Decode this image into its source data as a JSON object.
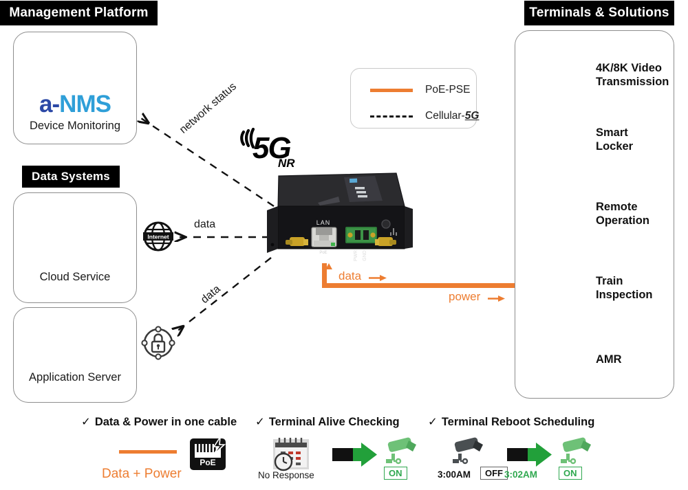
{
  "sections": {
    "management": {
      "badge": "Management Platform"
    },
    "data_systems": {
      "badge": "Data Systems"
    },
    "terminals": {
      "badge": "Terminals & Solutions"
    }
  },
  "cards": {
    "device_monitoring": {
      "label": "Device Monitoring",
      "logo_part1": "a-",
      "logo_part2": "NMS",
      "icon": "admin-user-alert-icon",
      "logo_color_primary": "#2c49a6",
      "logo_color_secondary": "#2f9fd8"
    },
    "cloud_service": {
      "label": "Cloud Service",
      "icon": "cloud-data-transfer-icon"
    },
    "application_server": {
      "label": "Application Server",
      "icon": "server-rack-database-icon"
    }
  },
  "legend": {
    "items": [
      {
        "style": "solid",
        "color": "#ED7D31",
        "label": "PoE-PSE"
      },
      {
        "style": "dashed",
        "color": "#111111",
        "label_prefix": "Cellular-",
        "label_emphasis": "5G"
      }
    ]
  },
  "device": {
    "name": "5G NR Industrial Router",
    "wireless_tag_main": "5G",
    "wireless_tag_sub": "NR",
    "ports": {
      "lan_label": "LAN",
      "poe_label": "PoE",
      "pwr_label": "PWR",
      "gnd_label": "GND"
    }
  },
  "connections": [
    {
      "id": "network-status",
      "label": "network status",
      "style": "dashed",
      "direction": "to-device-monitoring"
    },
    {
      "id": "data-internet",
      "label": "data",
      "style": "dashed",
      "direction": "to-cloud-service"
    },
    {
      "id": "data-vpn",
      "label": "data",
      "style": "dashed",
      "direction": "to-application-server"
    },
    {
      "id": "poe-data",
      "label": "data",
      "style": "solid",
      "color": "#ED7D31"
    },
    {
      "id": "poe-power",
      "label": "power",
      "style": "solid",
      "color": "#ED7D31"
    }
  ],
  "nodes": {
    "internet": {
      "label": "Internet",
      "icon": "globe-internet-icon"
    },
    "vpn": {
      "label": "",
      "icon": "secure-lock-icon"
    }
  },
  "terminals": {
    "items": [
      {
        "label": "4K/8K Video\nTransmission",
        "line1": "4K/8K Video",
        "line2": "Transmission",
        "icon": "dome-camera-icon"
      },
      {
        "label": "Smart Locker",
        "line1": "Smart",
        "line2": "Locker",
        "icon": "smart-locker-icon"
      },
      {
        "label": "Remote Operation",
        "line1": "Remote",
        "line2": "Operation",
        "icon": "excavator-icon"
      },
      {
        "label": "Train Inspection",
        "line1": "Train",
        "line2": "Inspection",
        "icon": "train-icon"
      },
      {
        "label": "AMR",
        "line1": "AMR",
        "line2": "",
        "icon": "amr-robot-icon"
      }
    ]
  },
  "features": [
    {
      "check": "✓",
      "title": "Data & Power in one cable",
      "caption": "Data + Power",
      "caption_color": "#ED7D31",
      "icon": "poe-rj45-icon",
      "icon_label": "PoE"
    },
    {
      "check": "✓",
      "title": "Terminal  Alive Checking",
      "status_caption": "No Response",
      "state_label": "ON",
      "icon_before": "calendar-clock-icon",
      "icon_arrow": "transition-arrow-icon",
      "icon_after": "camera-on-icon"
    },
    {
      "check": "✓",
      "title": "Terminal  Reboot Scheduling",
      "time_before": "3:00AM",
      "state_before": "OFF",
      "time_after": "3:02AM",
      "state_after": "ON",
      "icon_before": "camera-off-icon",
      "icon_arrow": "transition-arrow-icon",
      "icon_after": "camera-on-icon"
    }
  ],
  "colors": {
    "accent_orange": "#ED7D31",
    "green_on": "#2fa84f",
    "badge_bg": "#000000"
  }
}
